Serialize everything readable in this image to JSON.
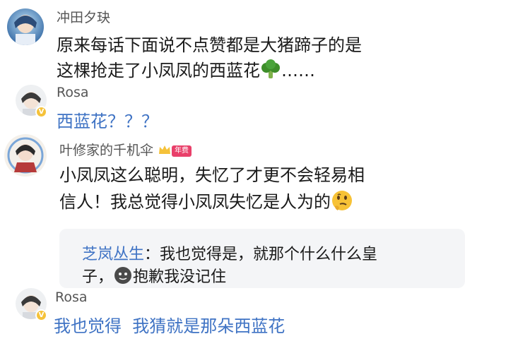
{
  "comments": [
    {
      "username": "冲田夕玦",
      "lines": [
        "原来每话下面说不点赞都是大猪蹄子的是",
        "这棵抢走了小凤凤的西蓝花",
        "……"
      ],
      "emoji": "broccoli-icon"
    },
    {
      "username": "Rosa",
      "verified": "V",
      "lines": [
        "西蓝花？？？"
      ]
    },
    {
      "username": "叶修家的千机伞",
      "badge": "年费",
      "lines": [
        "小凤凤这么聪明，失忆了才更不会轻易相",
        "信人！我总觉得小凤凤失忆是人为的"
      ],
      "emoji": "thinking-face-icon"
    },
    {
      "username": "Rosa",
      "verified": "V",
      "lines": [
        "我也觉得  我猜就是那朵西蓝花"
      ]
    }
  ],
  "quote": {
    "name": "芝岚丛生",
    "separator": "：",
    "line1": "我也觉得是，就那个什么什么皇",
    "line2_prefix": "子，",
    "line2_suffix": "抱歉我没记住",
    "emoji": "dark-smiley-icon"
  },
  "colors": {
    "link_blue": "#3f73c4",
    "username_gray": "#555555",
    "quote_bg": "#f4f5f7",
    "vip_gold": "#f5c23a",
    "year_badge": "#e9406a"
  }
}
